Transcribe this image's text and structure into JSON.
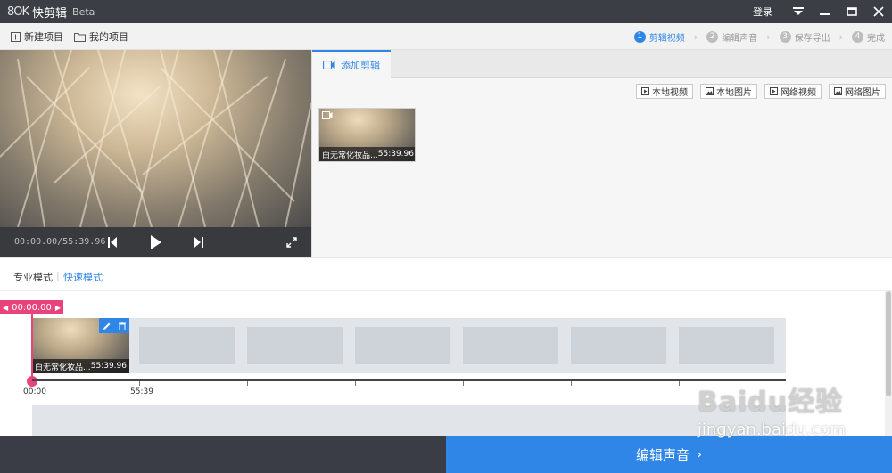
{
  "app": {
    "logo_text": "8OK",
    "name": "快剪辑",
    "version": "Beta",
    "login_label": "登录"
  },
  "toolbar": {
    "new_project": "新建项目",
    "my_projects": "我的项目"
  },
  "steps": [
    {
      "num": "1",
      "label": "剪辑视频",
      "active": true
    },
    {
      "num": "2",
      "label": "编辑声音",
      "active": false
    },
    {
      "num": "3",
      "label": "保存导出",
      "active": false
    },
    {
      "num": "4",
      "label": "完成",
      "active": false
    }
  ],
  "preview": {
    "time": "00:00.00/55:39.96"
  },
  "panel": {
    "tab_add": "添加剪辑",
    "buttons": {
      "local_video": "本地视频",
      "local_image": "本地图片",
      "web_video": "网络视频",
      "web_image": "网络图片"
    },
    "media": {
      "title": "白无常化妆品...",
      "duration": "55:39.96"
    }
  },
  "modes": {
    "pro": "专业模式",
    "quick": "快速模式"
  },
  "timeline": {
    "playhead": "00:00.00",
    "clip_title": "白无常化妆品...",
    "clip_duration": "55:39.96",
    "tick_start": "00:00",
    "tick_end": "55:39"
  },
  "footer": {
    "next_label": "编辑声音"
  },
  "watermark": {
    "line1": "Baidu经验",
    "line2": "jingyan.baidu.com"
  },
  "colors": {
    "accent": "#2f86e6",
    "playhead": "#e8437a",
    "titlebar": "#3b3e44"
  }
}
